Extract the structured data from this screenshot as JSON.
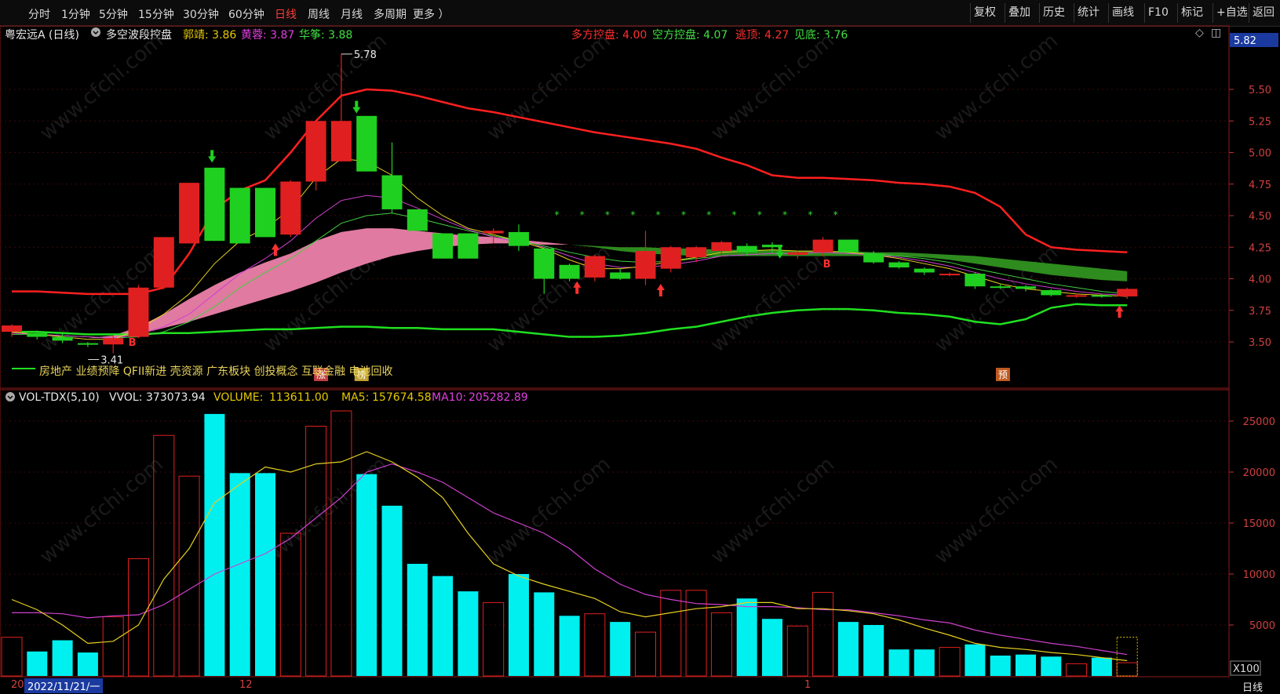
{
  "toolbar": {
    "periods": [
      "分时",
      "1分钟",
      "5分钟",
      "15分钟",
      "30分钟",
      "60分钟",
      "日线",
      "周线",
      "月线",
      "多周期",
      "更多 ）"
    ],
    "active_period": "日线",
    "right_tools": [
      "复权",
      "叠加",
      "历史",
      "统计",
      "画线",
      "F10",
      "标记",
      "+自选",
      "返回"
    ]
  },
  "stock": {
    "name": "粤宏远A (日线)"
  },
  "indicator": {
    "name": "多空波段控盘",
    "items_left": [
      {
        "label": "郭靖:",
        "value": "3.86",
        "color": "#e6c800"
      },
      {
        "label": "黄蓉:",
        "value": "3.87",
        "color": "#e040e0"
      },
      {
        "label": "华筝:",
        "value": "3.88",
        "color": "#40e040"
      }
    ],
    "items_right": [
      {
        "label": "多方控盘:",
        "value": "4.00",
        "color": "#ff3030"
      },
      {
        "label": "空方控盘:",
        "value": "4.07",
        "color": "#40e040"
      },
      {
        "label": "逃顶:",
        "value": "4.27",
        "color": "#ff3030"
      },
      {
        "label": "见底:",
        "value": "3.76",
        "color": "#40e040"
      }
    ]
  },
  "price_axis": {
    "current": "5.82",
    "ticks": [
      "5.50",
      "5.25",
      "5.00",
      "4.75",
      "4.50",
      "4.25",
      "4.00",
      "3.75",
      "3.50"
    ]
  },
  "annotations": {
    "high": "5.78",
    "low": "3.41",
    "buy_marker": "B"
  },
  "concepts": "房地产 业绩预降 QFII新进 壳资源 广东板块 创投概念 互联金融 电池回收",
  "event_tags": [
    {
      "text": "涨",
      "color": "#c04040"
    },
    {
      "text": "榜",
      "color": "#c0a030"
    },
    {
      "text": "预",
      "color": "#c05a20"
    }
  ],
  "volume": {
    "title": "VOL-TDX(5,10)",
    "vvol_label": "VVOL:",
    "vvol": "373073.94",
    "volume_label": "VOLUME:",
    "volume_value": "113611.00",
    "ma5_label": "MA5:",
    "ma5": "157674.58",
    "ma10_label": "MA10:",
    "ma10": "205282.89",
    "ticks": [
      "25000",
      "20000",
      "15000",
      "10000",
      "5000"
    ],
    "unit": "X100"
  },
  "x_axis": {
    "start": "20",
    "date_cursor": "2022/11/21/一",
    "month_dec": "12",
    "month_jan": "1",
    "period": "日线"
  },
  "watermark": "www.cfchi.com",
  "chart_data": {
    "type": "candlestick",
    "price_ylim": [
      3.4,
      5.9
    ],
    "volume_ylim": [
      0,
      27000
    ],
    "candles": [
      {
        "o": 3.58,
        "h": 3.64,
        "l": 3.54,
        "c": 3.63,
        "v": 3800
      },
      {
        "o": 3.57,
        "h": 3.59,
        "l": 3.52,
        "c": 3.54,
        "v": 2400
      },
      {
        "o": 3.54,
        "h": 3.58,
        "l": 3.49,
        "c": 3.51,
        "v": 3500
      },
      {
        "o": 3.49,
        "h": 3.5,
        "l": 3.46,
        "c": 3.48,
        "v": 2300
      },
      {
        "o": 3.48,
        "h": 3.55,
        "l": 3.41,
        "c": 3.53,
        "v": 5800
      },
      {
        "o": 3.54,
        "h": 3.95,
        "l": 3.53,
        "c": 3.93,
        "v": 11500
      },
      {
        "o": 3.93,
        "h": 4.33,
        "l": 3.92,
        "c": 4.33,
        "v": 23600
      },
      {
        "o": 4.28,
        "h": 4.76,
        "l": 4.28,
        "c": 4.76,
        "v": 19600
      },
      {
        "o": 4.88,
        "h": 4.88,
        "l": 4.3,
        "c": 4.3,
        "v": 25700
      },
      {
        "o": 4.72,
        "h": 4.72,
        "l": 4.28,
        "c": 4.28,
        "v": 19900
      },
      {
        "o": 4.72,
        "h": 4.72,
        "l": 4.33,
        "c": 4.33,
        "v": 19900
      },
      {
        "o": 4.35,
        "h": 4.78,
        "l": 4.33,
        "c": 4.77,
        "v": 14000
      },
      {
        "o": 4.77,
        "h": 5.25,
        "l": 4.7,
        "c": 5.25,
        "v": 24500
      },
      {
        "o": 4.93,
        "h": 5.78,
        "l": 4.93,
        "c": 5.25,
        "v": 26000
      },
      {
        "o": 5.29,
        "h": 5.29,
        "l": 4.85,
        "c": 4.85,
        "v": 19800
      },
      {
        "o": 4.82,
        "h": 5.08,
        "l": 4.52,
        "c": 4.55,
        "v": 16700
      },
      {
        "o": 4.55,
        "h": 4.55,
        "l": 4.38,
        "c": 4.38,
        "v": 11000
      },
      {
        "o": 4.36,
        "h": 4.36,
        "l": 4.16,
        "c": 4.16,
        "v": 9800
      },
      {
        "o": 4.36,
        "h": 4.36,
        "l": 4.16,
        "c": 4.16,
        "v": 8300
      },
      {
        "o": 4.36,
        "h": 4.4,
        "l": 4.28,
        "c": 4.38,
        "v": 7200
      },
      {
        "o": 4.37,
        "h": 4.43,
        "l": 4.22,
        "c": 4.26,
        "v": 10000
      },
      {
        "o": 4.24,
        "h": 4.25,
        "l": 3.88,
        "c": 4.0,
        "v": 8200
      },
      {
        "o": 4.11,
        "h": 4.12,
        "l": 3.98,
        "c": 4.0,
        "v": 5900
      },
      {
        "o": 4.01,
        "h": 4.19,
        "l": 3.98,
        "c": 4.18,
        "v": 6100
      },
      {
        "o": 4.05,
        "h": 4.08,
        "l": 3.99,
        "c": 4.0,
        "v": 5300
      },
      {
        "o": 4.0,
        "h": 4.38,
        "l": 3.95,
        "c": 4.22,
        "v": 4300
      },
      {
        "o": 4.08,
        "h": 4.26,
        "l": 4.05,
        "c": 4.25,
        "v": 8400
      },
      {
        "o": 4.17,
        "h": 4.26,
        "l": 4.13,
        "c": 4.25,
        "v": 8400
      },
      {
        "o": 4.22,
        "h": 4.3,
        "l": 4.18,
        "c": 4.29,
        "v": 6200
      },
      {
        "o": 4.26,
        "h": 4.28,
        "l": 4.18,
        "c": 4.21,
        "v": 7600
      },
      {
        "o": 4.27,
        "h": 4.29,
        "l": 4.21,
        "c": 4.25,
        "v": 5600
      },
      {
        "o": 4.19,
        "h": 4.22,
        "l": 4.16,
        "c": 4.21,
        "v": 4900
      },
      {
        "o": 4.21,
        "h": 4.33,
        "l": 4.18,
        "c": 4.31,
        "v": 8200
      },
      {
        "o": 4.31,
        "h": 4.31,
        "l": 4.21,
        "c": 4.21,
        "v": 5300
      },
      {
        "o": 4.2,
        "h": 4.22,
        "l": 4.12,
        "c": 4.13,
        "v": 5000
      },
      {
        "o": 4.13,
        "h": 4.14,
        "l": 4.08,
        "c": 4.09,
        "v": 2600
      },
      {
        "o": 4.08,
        "h": 4.09,
        "l": 4.03,
        "c": 4.05,
        "v": 2600
      },
      {
        "o": 4.04,
        "h": 4.05,
        "l": 4.02,
        "c": 4.04,
        "v": 2800
      },
      {
        "o": 4.04,
        "h": 4.05,
        "l": 3.92,
        "c": 3.94,
        "v": 3100
      },
      {
        "o": 3.94,
        "h": 3.96,
        "l": 3.92,
        "c": 3.93,
        "v": 2000
      },
      {
        "o": 3.94,
        "h": 3.95,
        "l": 3.9,
        "c": 3.92,
        "v": 2100
      },
      {
        "o": 3.91,
        "h": 3.92,
        "l": 3.86,
        "c": 3.87,
        "v": 1900
      },
      {
        "o": 3.86,
        "h": 3.88,
        "l": 3.85,
        "c": 3.87,
        "v": 1200
      },
      {
        "o": 3.87,
        "h": 3.88,
        "l": 3.85,
        "c": 3.86,
        "v": 1800
      },
      {
        "o": 3.86,
        "h": 3.93,
        "l": 3.84,
        "c": 3.92,
        "v": 1300
      }
    ],
    "upper_band": [
      3.9,
      3.9,
      3.89,
      3.88,
      3.88,
      3.88,
      3.93,
      4.2,
      4.55,
      4.7,
      4.78,
      5.0,
      5.25,
      5.45,
      5.5,
      5.49,
      5.45,
      5.4,
      5.35,
      5.32,
      5.28,
      5.24,
      5.2,
      5.16,
      5.13,
      5.1,
      5.07,
      5.03,
      4.96,
      4.9,
      4.82,
      4.8,
      4.8,
      4.79,
      4.78,
      4.76,
      4.75,
      4.73,
      4.68,
      4.57,
      4.35,
      4.25,
      4.23,
      4.22,
      4.21
    ],
    "lower_band": [
      3.58,
      3.58,
      3.57,
      3.56,
      3.56,
      3.56,
      3.57,
      3.57,
      3.58,
      3.59,
      3.6,
      3.6,
      3.61,
      3.62,
      3.62,
      3.61,
      3.61,
      3.6,
      3.6,
      3.6,
      3.58,
      3.56,
      3.54,
      3.54,
      3.55,
      3.57,
      3.6,
      3.62,
      3.66,
      3.7,
      3.73,
      3.75,
      3.76,
      3.76,
      3.75,
      3.73,
      3.72,
      3.7,
      3.66,
      3.64,
      3.68,
      3.77,
      3.8,
      3.79,
      3.79
    ],
    "ma_yellow": [
      3.58,
      3.56,
      3.54,
      3.52,
      3.52,
      3.6,
      3.72,
      3.88,
      4.12,
      4.3,
      4.4,
      4.55,
      4.8,
      4.95,
      4.93,
      4.82,
      4.64,
      4.5,
      4.4,
      4.35,
      4.3,
      4.24,
      4.15,
      4.08,
      4.08,
      4.1,
      4.14,
      4.17,
      4.21,
      4.22,
      4.23,
      4.22,
      4.22,
      4.21,
      4.19,
      4.16,
      4.12,
      4.08,
      4.02,
      3.96,
      3.92,
      3.9,
      3.88,
      3.87,
      3.86
    ],
    "ma_magenta": [
      3.57,
      3.56,
      3.55,
      3.54,
      3.53,
      3.56,
      3.62,
      3.72,
      3.88,
      4.04,
      4.16,
      4.3,
      4.48,
      4.62,
      4.66,
      4.64,
      4.56,
      4.47,
      4.39,
      4.33,
      4.29,
      4.25,
      4.18,
      4.12,
      4.09,
      4.09,
      4.11,
      4.14,
      4.18,
      4.19,
      4.2,
      4.2,
      4.21,
      4.2,
      4.19,
      4.17,
      4.14,
      4.1,
      4.05,
      4.0,
      3.96,
      3.93,
      3.9,
      3.88,
      3.87
    ],
    "ma_green": [
      3.56,
      3.56,
      3.55,
      3.54,
      3.53,
      3.54,
      3.58,
      3.66,
      3.78,
      3.93,
      4.05,
      4.16,
      4.3,
      4.44,
      4.5,
      4.52,
      4.48,
      4.43,
      4.38,
      4.34,
      4.3,
      4.26,
      4.21,
      4.17,
      4.14,
      4.13,
      4.14,
      4.16,
      4.18,
      4.19,
      4.2,
      4.2,
      4.21,
      4.2,
      4.2,
      4.18,
      4.16,
      4.13,
      4.08,
      4.04,
      4.0,
      3.96,
      3.93,
      3.9,
      3.88
    ],
    "pink_band_top": [
      3.55,
      3.55,
      3.54,
      3.53,
      3.55,
      3.62,
      3.72,
      3.84,
      3.95,
      4.05,
      4.13,
      4.2,
      4.3,
      4.37,
      4.4,
      4.4,
      4.38,
      4.36,
      4.34,
      4.33,
      4.31,
      4.29,
      4.27
    ],
    "pink_band_bottom": [
      3.55,
      3.55,
      3.54,
      3.53,
      3.53,
      3.56,
      3.61,
      3.66,
      3.72,
      3.78,
      3.84,
      3.9,
      3.97,
      4.05,
      4.12,
      4.18,
      4.22,
      4.25,
      4.27,
      4.28,
      4.28,
      4.27,
      4.27
    ],
    "green_band_top": [
      4.27,
      4.26,
      4.25,
      4.25,
      4.24,
      4.24,
      4.23,
      4.23,
      4.23,
      4.22,
      4.22,
      4.22,
      4.21,
      4.21,
      4.2,
      4.19,
      4.18,
      4.16,
      4.14,
      4.12,
      4.1,
      4.08,
      4.06
    ],
    "green_band_bottom": [
      4.27,
      4.25,
      4.22,
      4.2,
      4.19,
      4.18,
      4.18,
      4.18,
      4.18,
      4.18,
      4.18,
      4.18,
      4.18,
      4.18,
      4.17,
      4.15,
      4.12,
      4.09,
      4.06,
      4.03,
      4.01,
      3.99,
      3.98
    ],
    "vol_ma5": [
      7500,
      6500,
      5000,
      3200,
      3400,
      5000,
      9500,
      12500,
      17000,
      18800,
      20500,
      20000,
      20800,
      21000,
      22000,
      21000,
      19500,
      17500,
      14000,
      11000,
      9800,
      9000,
      8300,
      7600,
      6300,
      5800,
      6200,
      6600,
      6800,
      7200,
      7200,
      6600,
      6600,
      6400,
      6100,
      5500,
      4700,
      4000,
      3200,
      2800,
      2600,
      2300,
      2100,
      1800,
      1500
    ],
    "vol_ma10": [
      6200,
      6200,
      6100,
      5700,
      5900,
      6000,
      7000,
      8500,
      10000,
      11000,
      12000,
      13500,
      15500,
      17500,
      20000,
      20800,
      20000,
      19000,
      17500,
      16000,
      15000,
      14000,
      12500,
      10500,
      9000,
      8000,
      7500,
      7100,
      7000,
      6800,
      6800,
      6700,
      6500,
      6500,
      6200,
      5900,
      5500,
      5200,
      4500,
      4000,
      3600,
      3200,
      2900,
      2500,
      2100
    ]
  }
}
